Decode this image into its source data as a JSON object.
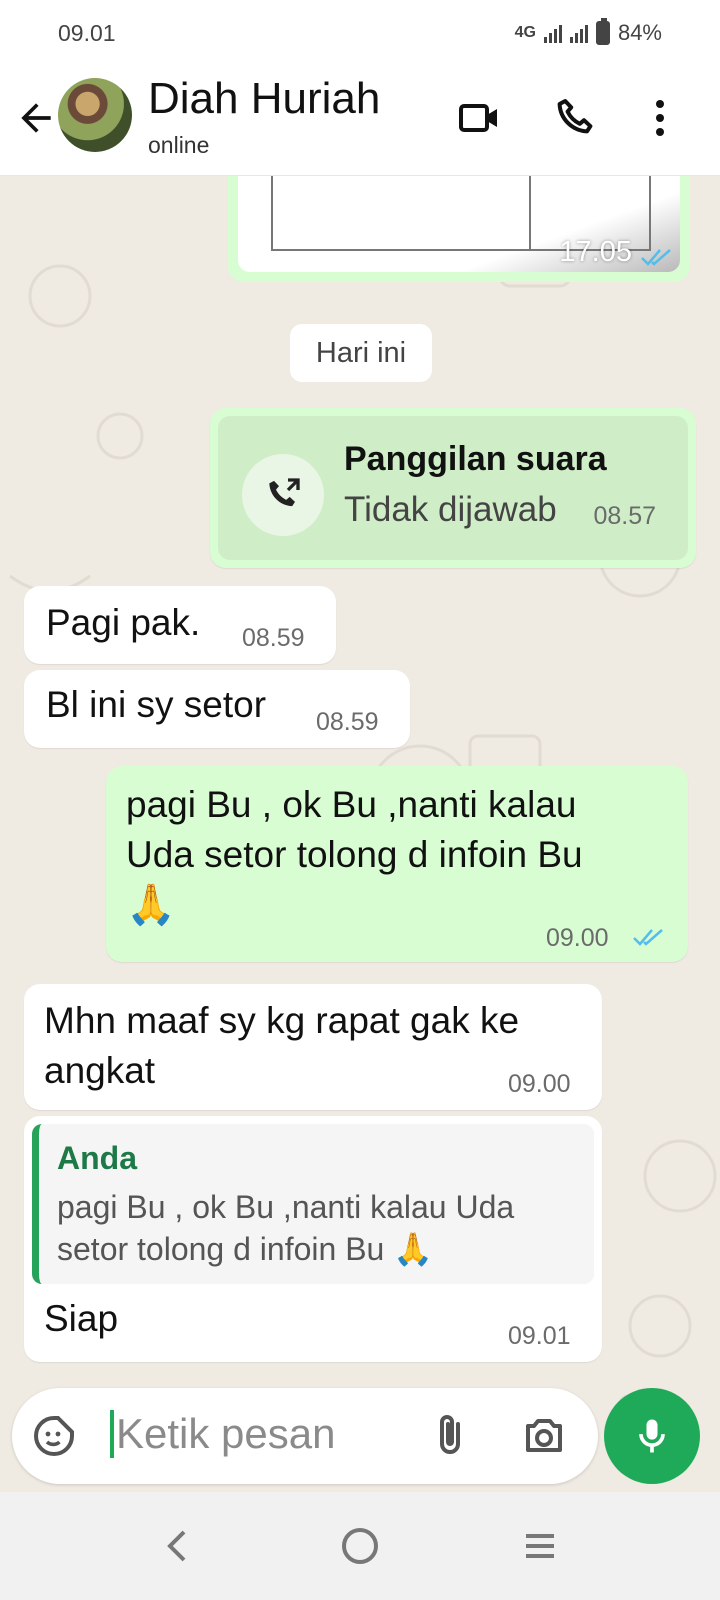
{
  "status_bar": {
    "time": "09.01",
    "network": "4G",
    "battery": "84%"
  },
  "header": {
    "contact_name": "Diah Huriah",
    "contact_status": "online"
  },
  "messages": {
    "image": {
      "time": "17.05"
    },
    "date_chip": "Hari ini",
    "call": {
      "title": "Panggilan suara",
      "subtitle": "Tidak dijawab",
      "time": "08.57"
    },
    "m1": {
      "text": "Pagi pak.",
      "time": "08.59"
    },
    "m2": {
      "text": "Bl ini sy setor",
      "time": "08.59"
    },
    "m3": {
      "line1": "pagi Bu , ok Bu ,nanti kalau",
      "line2": "Uda setor tolong d infoin Bu",
      "emoji": "🙏",
      "time": "09.00"
    },
    "m4": {
      "line1": "Mhn maaf sy kg rapat gak ke",
      "line2": "angkat",
      "time": "09.00"
    },
    "m5": {
      "quote_author": "Anda",
      "quote_line1": "pagi Bu , ok Bu ,nanti kalau Uda",
      "quote_line2": "setor tolong d infoin Bu 🙏",
      "text": "Siap",
      "time": "09.01"
    }
  },
  "input": {
    "placeholder": "Ketik pesan"
  },
  "colors": {
    "accent_green": "#1faa59",
    "outgoing_bubble": "#d9fdd3",
    "chat_background": "#efeae2",
    "read_ticks": "#53bdeb"
  }
}
